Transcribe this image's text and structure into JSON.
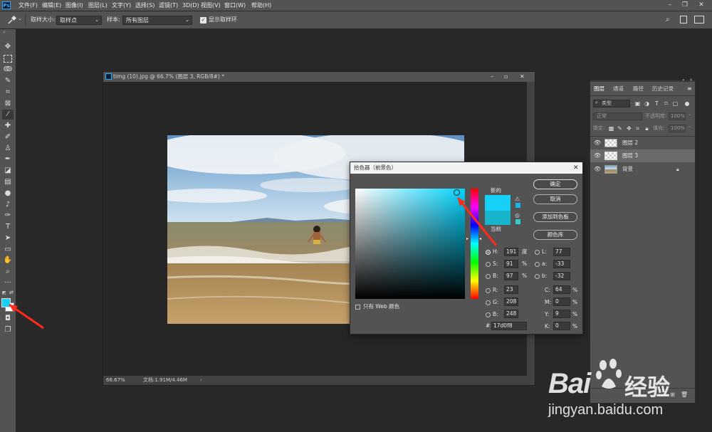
{
  "menubar": {
    "logo": "Ps",
    "items": [
      "文件(F)",
      "编辑(E)",
      "图像(I)",
      "图层(L)",
      "文字(Y)",
      "选择(S)",
      "滤镜(T)",
      "3D(D)",
      "视图(V)",
      "窗口(W)",
      "帮助(H)"
    ],
    "minimize": "–",
    "restore": "❐",
    "close": "✕"
  },
  "optbar": {
    "tool_icon": "eyedropper-icon",
    "sample_size_label": "取样大小:",
    "sample_size_value": "取样点",
    "sample_label": "样本:",
    "sample_value": "所有图层",
    "show_ring_label": "显示取样环",
    "show_ring_checked": true
  },
  "document": {
    "title": "timg (10).jpg @ 66.7% (图层 3, RGB/8#) *",
    "zoom": "66.67%",
    "doc_size": "文档:1.91M/4.46M"
  },
  "picker": {
    "title": "拾色器（前景色）",
    "ok": "确定",
    "cancel": "取消",
    "add_swatch": "添加到色板",
    "color_libraries": "颜色库",
    "new_label": "新的",
    "current_label": "当前",
    "only_web": "只有 Web 颜色",
    "new_color": "#17d0f8",
    "current_color": "#17b4cc",
    "hsb": {
      "H": "191",
      "H_unit": "度",
      "S": "91",
      "S_unit": "%",
      "B": "97",
      "B_unit": "%"
    },
    "rgb": {
      "R": "23",
      "G": "208",
      "B": "248"
    },
    "lab": {
      "L": "77",
      "a": "-33",
      "b": "-32"
    },
    "cmyk": {
      "C": "64",
      "M": "0",
      "Y": "9",
      "K": "0",
      "unit": "%"
    },
    "hex_label": "#",
    "hex": "17d0f8",
    "hue_field_color": "#00d4ff"
  },
  "layers_panel": {
    "tabs": [
      "图层",
      "通道",
      "路径",
      "历史记录"
    ],
    "filter_label": "类型",
    "blend_mode": "正常",
    "opacity_label": "不透明度:",
    "opacity_value": "100%",
    "lock_label": "锁定:",
    "fill_label": "填充:",
    "fill_value": "100%",
    "layers": [
      {
        "name": "图层 2",
        "selected": false
      },
      {
        "name": "图层 3",
        "selected": true
      },
      {
        "name": "背景",
        "selected": false
      }
    ]
  },
  "colors": {
    "foreground": "#17d0f8",
    "arrow": "#ff2a1a"
  },
  "watermark": {
    "brand_left": "Bai",
    "brand_right": "经验",
    "url": "jingyan.baidu.com"
  }
}
